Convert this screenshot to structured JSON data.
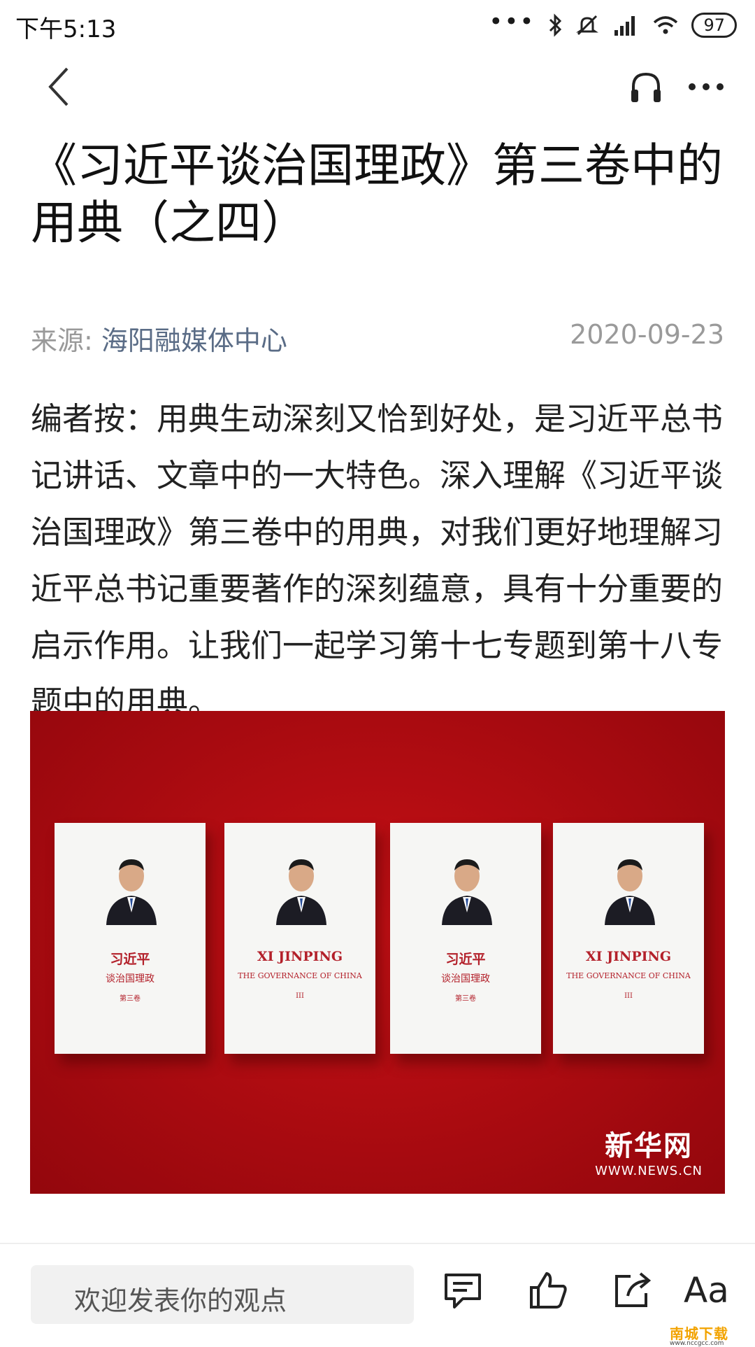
{
  "status_bar": {
    "time": "下午5:13",
    "battery": "97"
  },
  "nav": {
    "back_label": "back",
    "headset_label": "listen",
    "more_label": "more"
  },
  "article": {
    "title": "《习近平谈治国理政》第三卷中的用典（之四）",
    "source_prefix": "来源:",
    "source_name": "海阳融媒体中心",
    "date": "2020-09-23",
    "intro": "编者按：用典生动深刻又恰到好处，是习近平总书记讲话、文章中的一大特色。深入理解《习近平谈治国理政》第三卷中的用典，对我们更好地理解习近平总书记重要著作的深刻蕴意，具有十分重要的启示作用。让我们一起学习第十七专题到第十八专题中的用典。"
  },
  "image": {
    "books": [
      {
        "line1": "习近平",
        "line2": "谈治国理政",
        "line3": "第三卷"
      },
      {
        "line1": "XI JINPING",
        "line2": "THE GOVERNANCE OF CHINA",
        "line3": "III"
      },
      {
        "line1": "习近平",
        "line2": "谈治国理政",
        "line3": "第三卷"
      },
      {
        "line1": "XI JINPING",
        "line2": "THE GOVERNANCE OF CHINA",
        "line3": "III"
      }
    ],
    "watermark_title": "新华网",
    "watermark_url": "WWW.NEWS.CN"
  },
  "bottom_bar": {
    "comment_placeholder": "欢迎发表你的观点",
    "font_button": "Aa",
    "brand": "南城下载",
    "brand_url": "www.nccgcc.com"
  },
  "colors": {
    "accent_red": "#b3080f",
    "source_blue": "#5a6c86"
  }
}
